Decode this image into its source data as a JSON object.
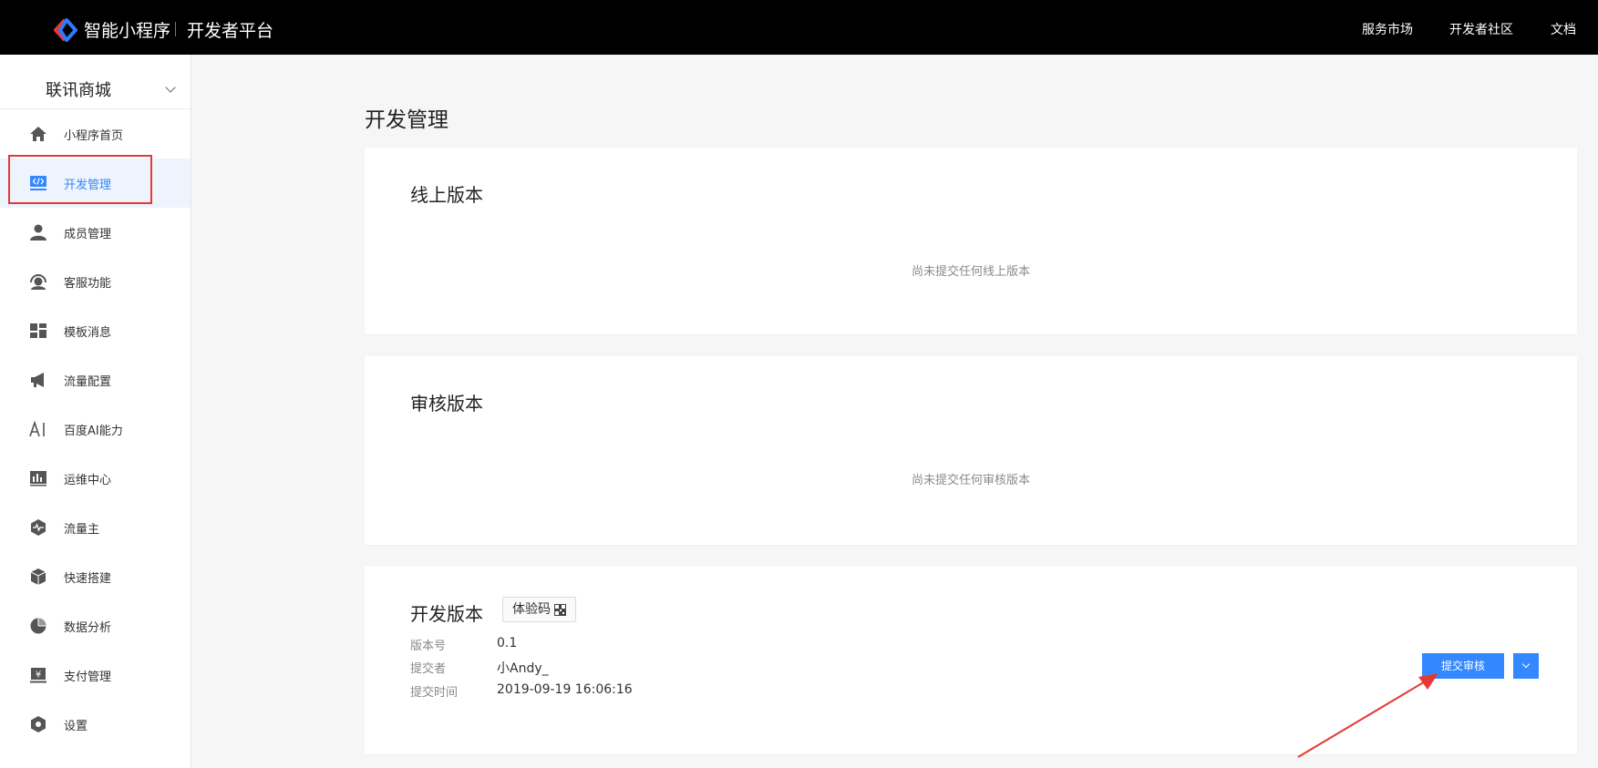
{
  "header": {
    "brand_title": "智能小程序",
    "brand_subtitle": "开发者平台",
    "nav": [
      "服务市场",
      "开发者社区",
      "文档"
    ]
  },
  "sidebar": {
    "app_name": "联讯商城",
    "items": [
      {
        "label": "小程序首页",
        "icon": "home-icon"
      },
      {
        "label": "开发管理",
        "icon": "code-icon",
        "active": true
      },
      {
        "label": "成员管理",
        "icon": "user-icon"
      },
      {
        "label": "客服功能",
        "icon": "headset-icon"
      },
      {
        "label": "模板消息",
        "icon": "template-icon"
      },
      {
        "label": "流量配置",
        "icon": "megaphone-icon"
      },
      {
        "label": "百度AI能力",
        "icon": "ai-icon"
      },
      {
        "label": "运维中心",
        "icon": "chart-icon"
      },
      {
        "label": "流量主",
        "icon": "pulse-icon"
      },
      {
        "label": "快速搭建",
        "icon": "cube-icon"
      },
      {
        "label": "数据分析",
        "icon": "pie-icon"
      },
      {
        "label": "支付管理",
        "icon": "payment-icon"
      },
      {
        "label": "设置",
        "icon": "settings-icon"
      }
    ]
  },
  "main": {
    "page_title": "开发管理",
    "online": {
      "title": "线上版本",
      "empty": "尚未提交任何线上版本"
    },
    "review": {
      "title": "审核版本",
      "empty": "尚未提交任何审核版本"
    },
    "dev": {
      "title": "开发版本",
      "qr_label": "体验码",
      "version_label": "版本号",
      "version_value": "0.1",
      "submitter_label": "提交者",
      "submitter_value": "小Andy_",
      "time_label": "提交时间",
      "time_value": "2019-09-19 16:06:16",
      "submit_button": "提交审核"
    }
  },
  "colors": {
    "accent": "#3388ff",
    "highlight": "#e53935",
    "topbar": "#000000"
  }
}
